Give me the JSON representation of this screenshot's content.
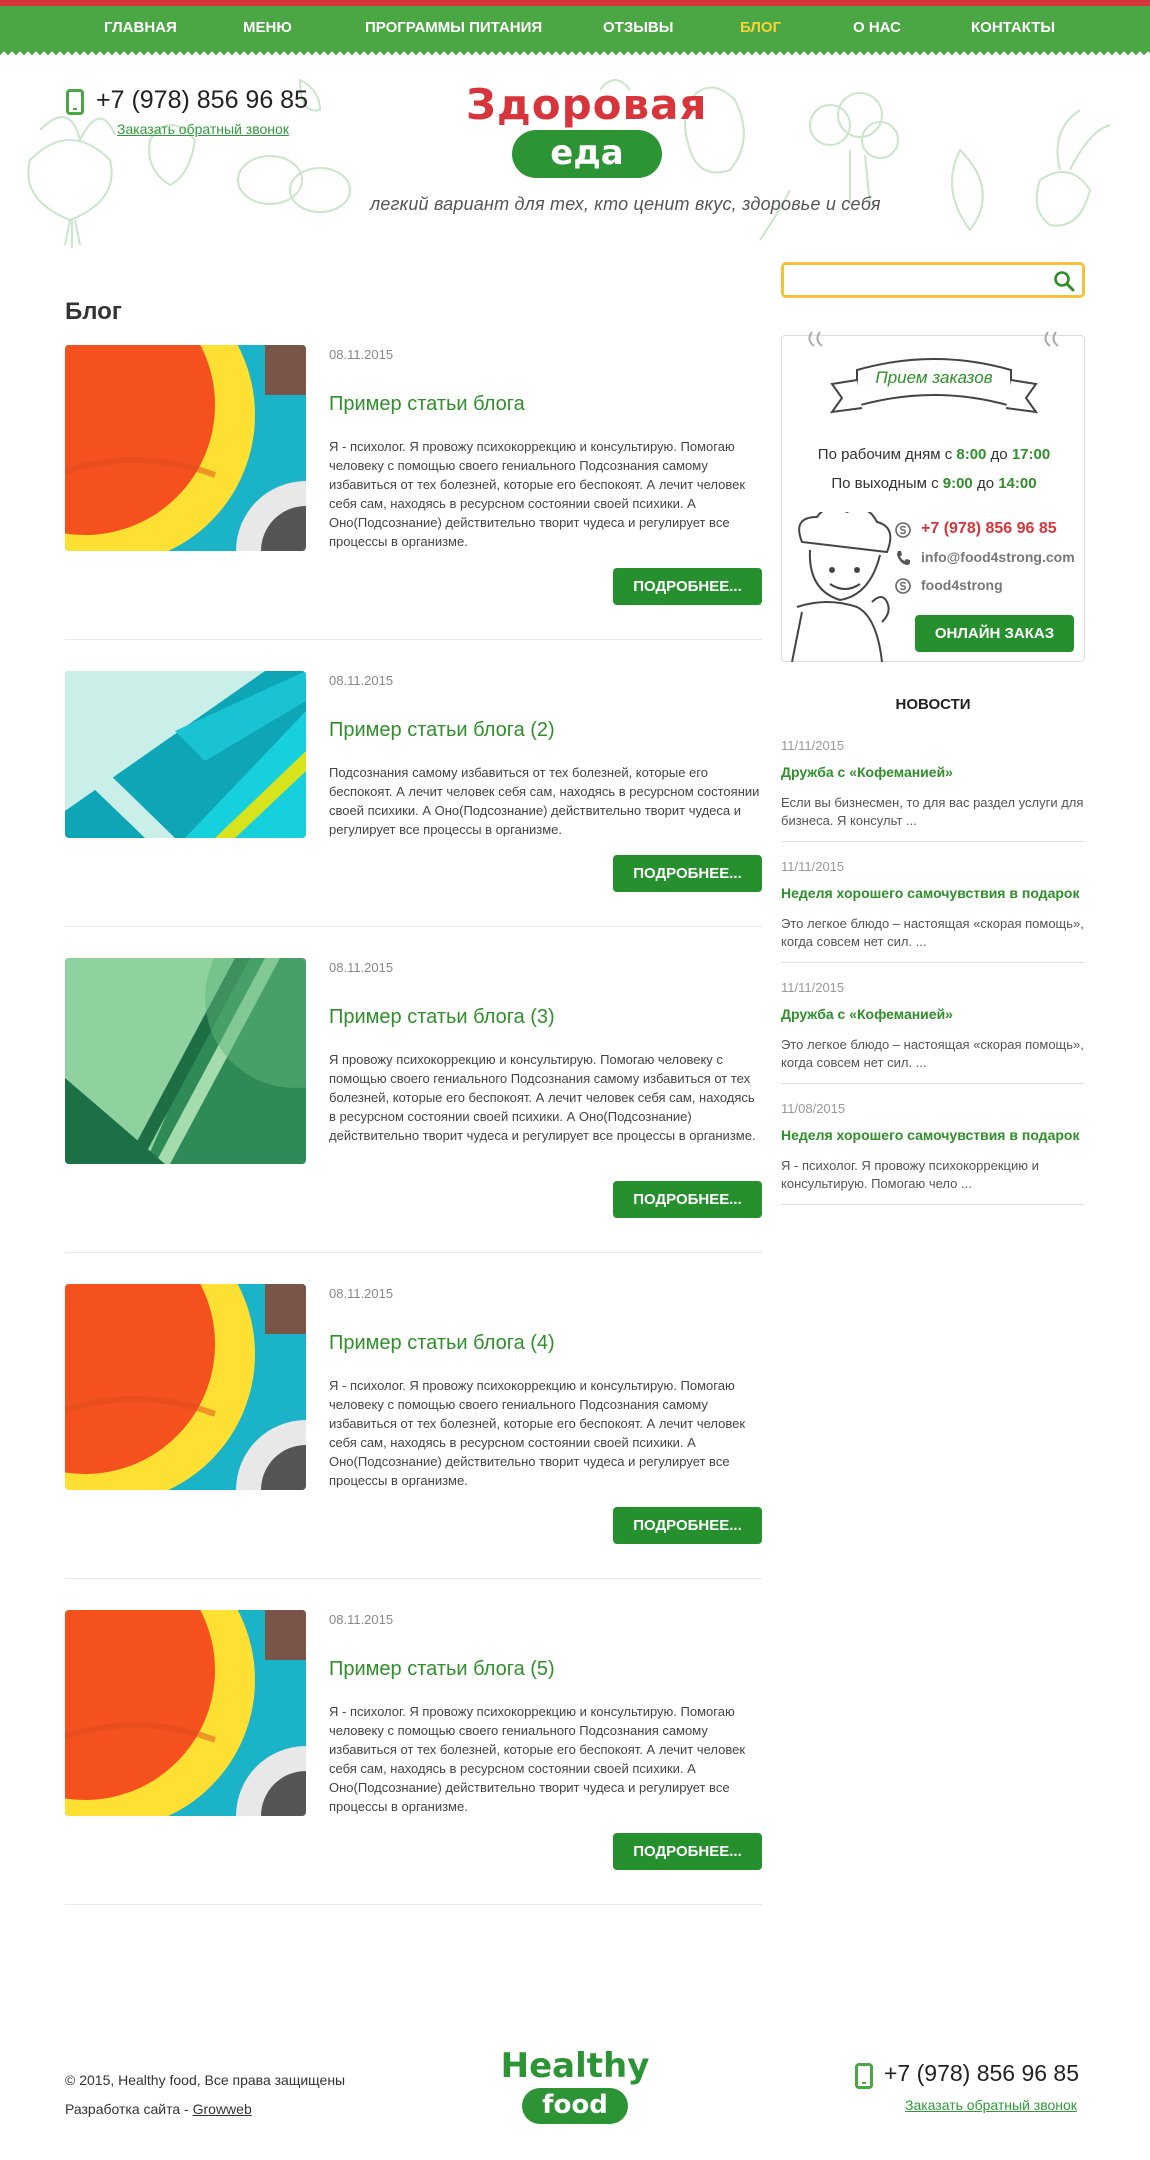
{
  "nav": {
    "items": [
      {
        "label": "ГЛАВНАЯ",
        "active": false
      },
      {
        "label": "МЕНЮ",
        "active": false
      },
      {
        "label": "ПРОГРАММЫ ПИТАНИЯ",
        "active": false
      },
      {
        "label": "ОТЗЫВЫ",
        "active": false
      },
      {
        "label": "БЛОГ",
        "active": true
      },
      {
        "label": "О НАС",
        "active": false
      },
      {
        "label": "КОНТАКТЫ",
        "active": false
      }
    ]
  },
  "header": {
    "phone": "+7 (978) 856 96 85",
    "callback_link": "Заказать обратный звонок",
    "logo_title": "Здоровая",
    "logo_pill": "еда",
    "tagline": "легкий вариант для тех, кто ценит вкус, здоровье и себя"
  },
  "main": {
    "title": "Блог",
    "more_label": "ПОДРОБНЕЕ...",
    "posts": [
      {
        "date": "08.11.2015",
        "title": "Пример статьи блога",
        "thumb": "orange-circle",
        "text": "Я - психолог. Я провожу психокоррекцию и консультирую. Помогаю человеку с помощью своего гениального Подсознания самому избавиться от тех болезней, которые его беспокоят. А лечит человек себя сам, находясь в ресурсном состоянии своей психики. А Оно(Подсознание) действительно творит чудеса и регулирует все процессы в организме."
      },
      {
        "date": "08.11.2015",
        "title": "Пример статьи блога (2)",
        "thumb": "teal-diagonal",
        "text": "Подсознания самому избавиться от тех болезней, которые его беспокоят. А лечит человек себя сам, находясь в ресурсном состоянии своей психики. А Оно(Подсознание) действительно творит чудеса и регулирует все процессы в организме."
      },
      {
        "date": "08.11.2015",
        "title": "Пример статьи блога (3)",
        "thumb": "green-diagonal",
        "text": "Я провожу психокоррекцию и консультирую. Помогаю человеку с помощью своего гениального Подсознания самому избавиться от тех болезней, которые его беспокоят. А лечит человек себя сам, находясь в ресурсном состоянии своей психики. А Оно(Подсознание) действительно творит чудеса и регулирует все процессы в организме."
      },
      {
        "date": "08.11.2015",
        "title": "Пример статьи блога (4)",
        "thumb": "orange-circle",
        "text": "Я - психолог. Я провожу психокоррекцию и консультирую. Помогаю человеку с помощью своего гениального Подсознания самому избавиться от тех болезней, которые его беспокоят. А лечит человек себя сам, находясь в ресурсном состоянии своей психики. А Оно(Подсознание) действительно творит чудеса и регулирует все процессы в организме."
      },
      {
        "date": "08.11.2015",
        "title": "Пример статьи блога (5)",
        "thumb": "orange-circle",
        "text": "Я - психолог. Я провожу психокоррекцию и консультирую. Помогаю человеку с помощью своего гениального Подсознания самому избавиться от тех болезней, которые его беспокоят. А лечит человек себя сам, находясь в ресурсном состоянии своей психики. А Оно(Подсознание) действительно творит чудеса и регулирует все процессы в организме."
      }
    ]
  },
  "sidebar": {
    "search": {
      "value": "",
      "placeholder": ""
    },
    "order": {
      "banner": "Прием заказов",
      "weekdays_prefix": "По рабочим дням с ",
      "weekdays_from": "8:00",
      "weekdays_mid": " до ",
      "weekdays_to": "17:00",
      "weekend_prefix": "По выходным с ",
      "weekend_from": "9:00",
      "weekend_mid": " до ",
      "weekend_to": "14:00",
      "phone": "+7 (978) 856 96 85",
      "email": "info@food4strong.com",
      "skype": "food4strong",
      "button": "ОНЛАЙН ЗАКАЗ"
    },
    "news_title": "НОВОСТИ",
    "news": [
      {
        "date": "11/11/2015",
        "title": "Дружба с «Кофеманией»",
        "text": "Если вы бизнесмен, то для вас раздел услуги для бизнеса. Я консульт ..."
      },
      {
        "date": "11/11/2015",
        "title": "Неделя хорошего самочувствия в подарок",
        "text": "Это легкое блюдо – настоящая «скорая помощь», когда совсем нет сил. ..."
      },
      {
        "date": "11/11/2015",
        "title": "Дружба с «Кофеманией»",
        "text": "Это легкое блюдо – настоящая «скорая помощь», когда совсем нет сил. ..."
      },
      {
        "date": "11/08/2015",
        "title": "Неделя хорошего самочувствия в подарок",
        "text": "Я - психолог. Я провожу психокоррекцию и консультирую. Помогаю чело ..."
      }
    ]
  },
  "footer": {
    "copyright": "© 2015, Healthy food, Все права защищены",
    "dev_prefix": "Разработка сайта - ",
    "dev_link": "Growweb",
    "logo_title": "Healthy",
    "logo_pill": "food",
    "phone": "+7 (978) 856 96 85",
    "callback_link": "Заказать обратный звонок"
  },
  "colors": {
    "nav_green": "#4ba644",
    "accent_red": "#d8343c",
    "button_green": "#25902d",
    "link_green": "#2f8f2a",
    "nav_active": "#f6d43a",
    "search_border": "#f3c33c"
  }
}
